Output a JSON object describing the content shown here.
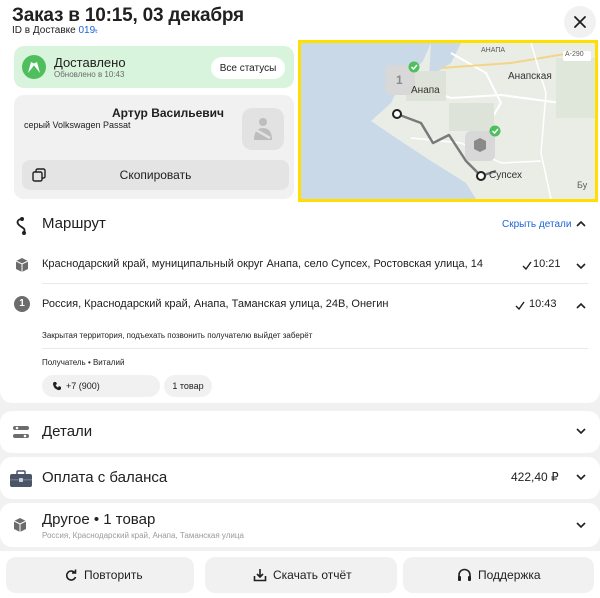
{
  "header": {
    "title": "Заказ в 10:15, 03 декабря",
    "id_prefix": "ID в Доставке ",
    "id_value": "019ₜ"
  },
  "status": {
    "label": "Доставлено",
    "updated": "Обновлено в 10:43",
    "all_statuses_button": "Все статусы"
  },
  "driver": {
    "name": "Артур Васильевич",
    "car": "серый Volkswagen Passat",
    "copy_button": "Скопировать"
  },
  "map": {
    "labels": [
      "Анапская",
      "Анапа",
      "Супсех",
      "Бу",
      "АНАПА",
      "А-290"
    ],
    "pin_label": "1"
  },
  "route": {
    "title": "Маршрут",
    "hide_details": "Скрыть детали",
    "points": [
      {
        "address": "Краснодарский край, муниципальный округ Анапа, село Супсех, Ростовская улица, 14",
        "time": "10:21"
      },
      {
        "number": "1",
        "address": "Россия, Краснодарский край, Анапа, Таманская улица, 24В, Онегин",
        "time": "10:43"
      }
    ],
    "note": "Закрытая территория, подъехать позвонить получателю выйдет заберёт",
    "recipient": "Получатель • Виталий",
    "phone": "+7 (900)",
    "items": "1 товар"
  },
  "details": {
    "title": "Детали"
  },
  "payment": {
    "title": "Оплата с баланса",
    "amount": "422,40 ₽"
  },
  "other": {
    "title": "Другое • 1 товар",
    "subtitle": "Россия, Краснодарский край, Анапа, Таманская улица"
  },
  "actions": {
    "repeat": "Повторить",
    "report": "Скачать отчёт",
    "support": "Поддержка"
  },
  "colors": {
    "accent_blue": "#1e63d6",
    "success_green": "#4fbf5e",
    "status_bg": "#d9f4dd",
    "highlight": "#ffde00"
  }
}
